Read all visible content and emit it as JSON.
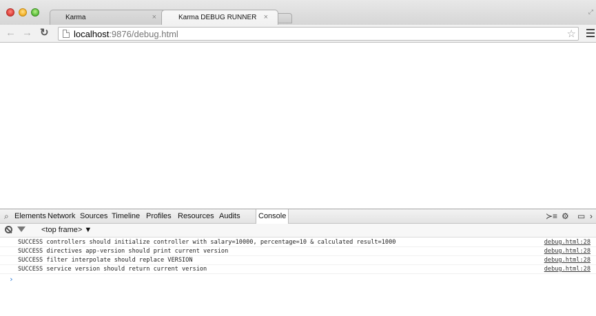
{
  "browser": {
    "tabs": [
      {
        "label": "Karma",
        "close": "×"
      },
      {
        "label": "Karma DEBUG RUNNER",
        "close": "×"
      }
    ],
    "url_host": "localhost",
    "url_port": ":9876",
    "url_path": "/debug.html"
  },
  "devtools": {
    "tabs": [
      "Elements",
      "Network",
      "Sources",
      "Timeline",
      "Profiles",
      "Resources",
      "Audits",
      "Console"
    ],
    "active_tab": "Console",
    "frame_selector": "<top frame> ▼",
    "console_rows": [
      {
        "message": "SUCCESS controllers should initialize controller with salary=10000, percentage=10 & calculated result=1000",
        "source": "debug.html:28"
      },
      {
        "message": "SUCCESS directives app-version should print current version",
        "source": "debug.html:28"
      },
      {
        "message": "SUCCESS filter interpolate should replace VERSION",
        "source": "debug.html:28"
      },
      {
        "message": "SUCCESS service version should return current version",
        "source": "debug.html:28"
      }
    ],
    "prompt": "›"
  }
}
